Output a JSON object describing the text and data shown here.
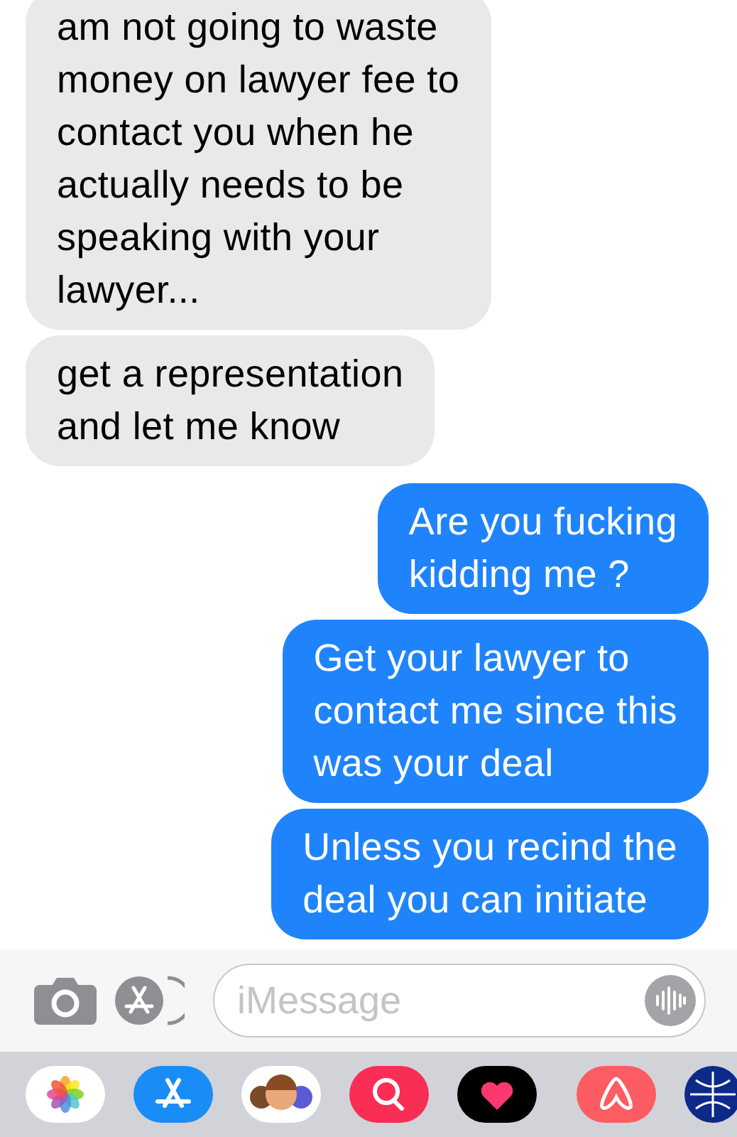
{
  "messages": [
    {
      "kind": "incoming",
      "text": "am not going to waste\nmoney on lawyer fee to\ncontact you when he\nactually needs to be\nspeaking with your\nlawyer..."
    },
    {
      "kind": "incoming",
      "text": "get a representation\nand let me know"
    },
    {
      "kind": "outgoing",
      "text": "Are you fucking\nkidding me ?"
    },
    {
      "kind": "outgoing",
      "text": "Get your lawyer to\ncontact me since this\nwas your deal"
    },
    {
      "kind": "outgoing",
      "text": "Unless you recind the\ndeal you can initiate"
    }
  ],
  "compose": {
    "placeholder": "iMessage"
  }
}
